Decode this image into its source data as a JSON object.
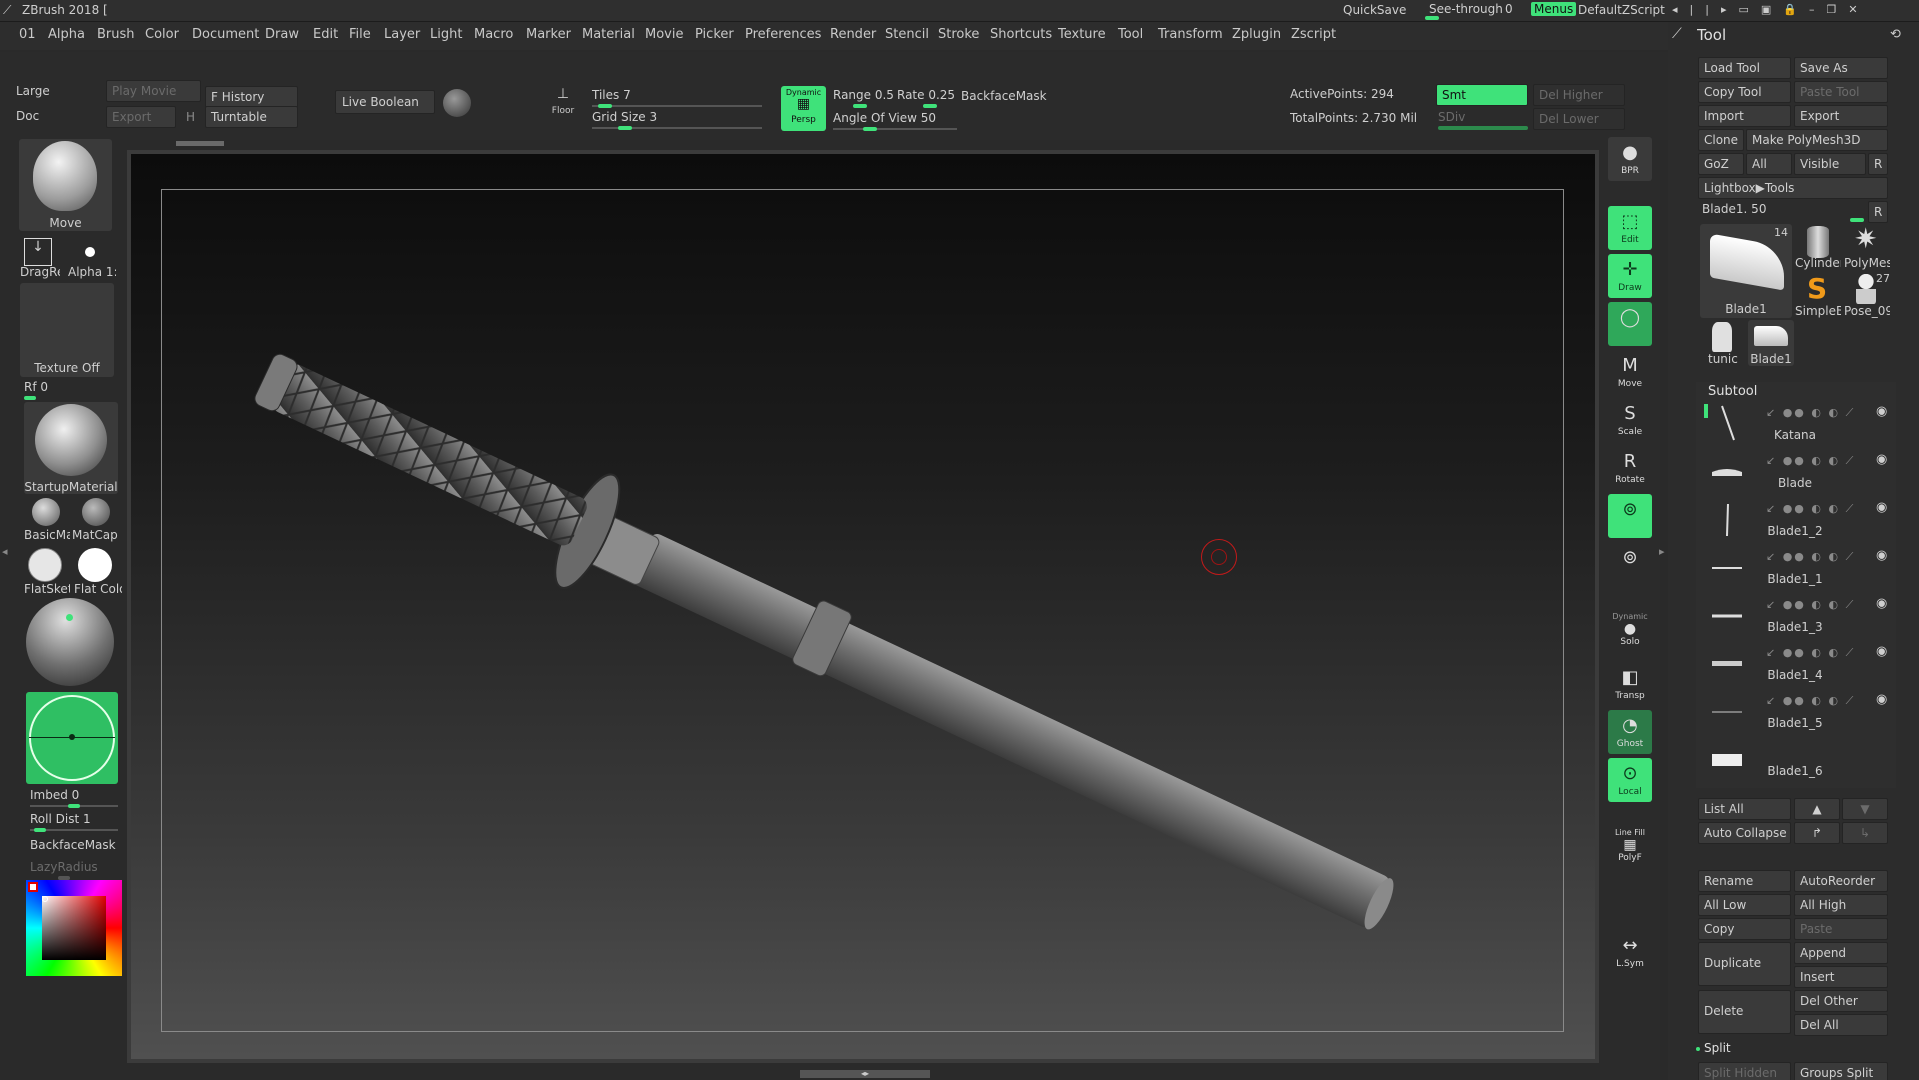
{
  "window": {
    "title": "ZBrush 2018 [",
    "quicksave": "QuickSave",
    "see_through_label": "See-through",
    "see_through_value": "0",
    "menus_button": "Menus",
    "default_zscript": "DefaultZScript"
  },
  "menubar": [
    "01",
    "Alpha",
    "Brush",
    "Color",
    "Document",
    "Draw",
    "Edit",
    "File",
    "Layer",
    "Light",
    "Macro",
    "Marker",
    "Material",
    "Movie",
    "Picker",
    "Preferences",
    "Render",
    "Stencil",
    "Stroke",
    "Shortcuts",
    "Texture",
    "Tool",
    "Transform",
    "Zplugin",
    "Zscript"
  ],
  "top_shelf": {
    "large": "Large",
    "doc": "Doc",
    "play_movie": "Play Movie",
    "export": "Export",
    "h": "H",
    "f_history": "F History",
    "turntable": "Turntable",
    "live_boolean": "Live Boolean",
    "floor": "Floor",
    "tiles": "Tiles 7",
    "grid_size": "Grid Size 3",
    "persp": "Persp",
    "dynamic": "Dynamic",
    "range": "Range 0.5",
    "rate": "Rate 0.25",
    "backface_mask": "BackfaceMask",
    "angle_of_view": "Angle Of View 50",
    "active_points": "ActivePoints: 294",
    "total_points": "TotalPoints: 2.730 Mil",
    "smt": "Smt",
    "sdiv": "SDiv",
    "del_higher": "Del Higher",
    "del_lower": "Del Lower"
  },
  "left_shelf": {
    "brush_name": "Move",
    "stroke_name": "DragRect",
    "alpha_name": "Alpha 1:",
    "texture": "Texture Off",
    "rf": "Rf 0",
    "material": "StartupMaterial",
    "mat1": "BasicMa",
    "mat2": "MatCap",
    "mat3": "FlatSket",
    "mat4": "Flat Colo",
    "imbed": "Imbed 0",
    "roll_dist": "Roll Dist 1",
    "backface_mask": "BackfaceMask",
    "lazy_radius": "LazyRadius"
  },
  "right_shelf": [
    "BPR",
    "Edit",
    "Draw",
    "",
    "Move",
    "Scale",
    "Rotate",
    "",
    "",
    "Solo",
    "Transp",
    "Ghost",
    "Local",
    "PolyF",
    "L.Sym"
  ],
  "right_shelf_extra": {
    "dynamic": "Dynamic",
    "line_fill": "Line Fill"
  },
  "tool_panel": {
    "title": "Tool",
    "load_tool": "Load Tool",
    "save_as": "Save As",
    "copy_tool": "Copy Tool",
    "paste_tool": "Paste Tool",
    "import": "Import",
    "export": "Export",
    "clone": "Clone",
    "make_polymesh": "Make PolyMesh3D",
    "goz": "GoZ",
    "all": "All",
    "visible": "Visible",
    "r": "R",
    "lightbox_tools": "Lightbox▶Tools",
    "current_tool": "Blade1. 50",
    "tools": [
      {
        "name": "Blade1",
        "badge": "14"
      },
      {
        "name": "Cylinder",
        "badge": ""
      },
      {
        "name": "PolyMes",
        "badge": ""
      },
      {
        "name": "SimpleB",
        "badge": ""
      },
      {
        "name": "Pose_09",
        "badge": "27"
      },
      {
        "name": "tunic",
        "badge": ""
      },
      {
        "name": "Blade1",
        "badge": ""
      }
    ],
    "subtool_header": "Subtool",
    "subtools": [
      "Katana",
      "Blade",
      "Blade1_2",
      "Blade1_1",
      "Blade1_3",
      "Blade1_4",
      "Blade1_5",
      "Blade1_6"
    ],
    "list_all": "List All",
    "auto_collapse": "Auto Collapse",
    "rename": "Rename",
    "auto_reorder": "AutoReorder",
    "all_low": "All Low",
    "all_high": "All High",
    "copy": "Copy",
    "paste": "Paste",
    "duplicate": "Duplicate",
    "append": "Append",
    "insert": "Insert",
    "del_other": "Del Other",
    "delete": "Delete",
    "del_all": "Del All",
    "split": "Split",
    "split_hidden": "Split Hidden",
    "groups_split": "Groups Split"
  },
  "colors": {
    "accent": "#3fe27a",
    "background": "#2a2a2a",
    "canvas": "#1c1c1c"
  }
}
